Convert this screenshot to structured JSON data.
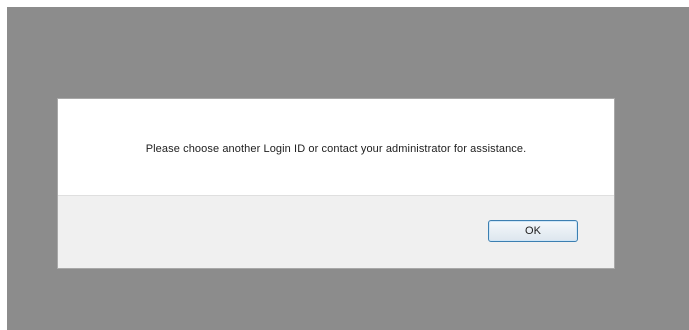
{
  "dialog": {
    "message": "Please choose another Login ID or contact your administrator for assistance.",
    "ok_label": "OK"
  }
}
